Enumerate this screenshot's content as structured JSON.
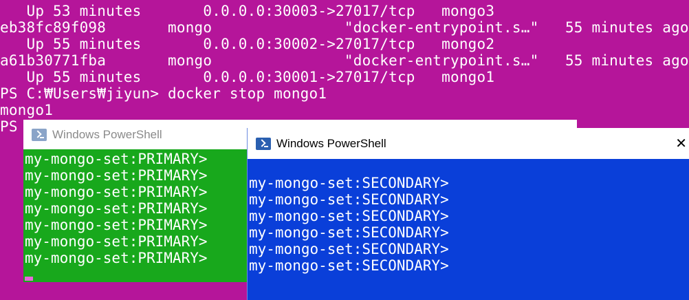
{
  "background_terminal": {
    "lines": [
      "   Up 53 minutes       0.0.0.0:30003->27017/tcp   mongo3",
      "eb38fc89f098       mongo               \"docker-entrypoint.s…\"   55 minutes ago",
      "   Up 55 minutes       0.0.0.0:30002->27017/tcp   mongo2",
      "a61b30771fba       mongo               \"docker-entrypoint.s…\"   55 minutes ago",
      "   Up 55 minutes       0.0.0.0:30001->27017/tcp   mongo1",
      "PS C:₩Users₩jiyun> docker stop mongo1",
      "mongo1",
      "PS"
    ],
    "color": "#b5159a"
  },
  "primary_window": {
    "title": "Windows PowerShell",
    "icon": "powershell-icon",
    "lines": [
      "my-mongo-set:PRIMARY>",
      "my-mongo-set:PRIMARY>",
      "my-mongo-set:PRIMARY>",
      "my-mongo-set:PRIMARY>",
      "my-mongo-set:PRIMARY>",
      "my-mongo-set:PRIMARY>",
      "my-mongo-set:PRIMARY>"
    ],
    "color": "#18a81c"
  },
  "secondary_window": {
    "title": "Windows PowerShell",
    "icon": "powershell-icon",
    "lines": [
      "my-mongo-set:SECONDARY>",
      "my-mongo-set:SECONDARY>",
      "my-mongo-set:SECONDARY>",
      "my-mongo-set:SECONDARY>",
      "my-mongo-set:SECONDARY>",
      "my-mongo-set:SECONDARY>"
    ],
    "color": "#0a3fd9"
  }
}
